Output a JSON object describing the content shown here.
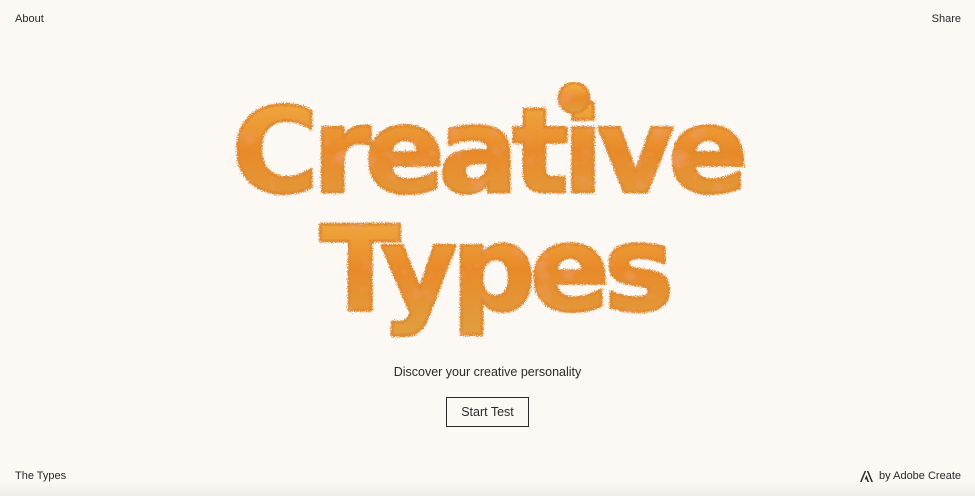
{
  "nav": {
    "about": "About",
    "share": "Share",
    "the_types": "The Types"
  },
  "hero": {
    "line1": "Creative",
    "line2": "Types",
    "tagline": "Discover your creative personality",
    "cta": "Start Test"
  },
  "footer": {
    "credit": "by Adobe Create",
    "logo_icon": "adobe-icon"
  },
  "colors": {
    "background": "#fcf9f4",
    "text": "#2a2a2a",
    "fur_dark": "#d9541c",
    "fur_mid": "#e98a2a",
    "fur_light": "#f2b446"
  }
}
